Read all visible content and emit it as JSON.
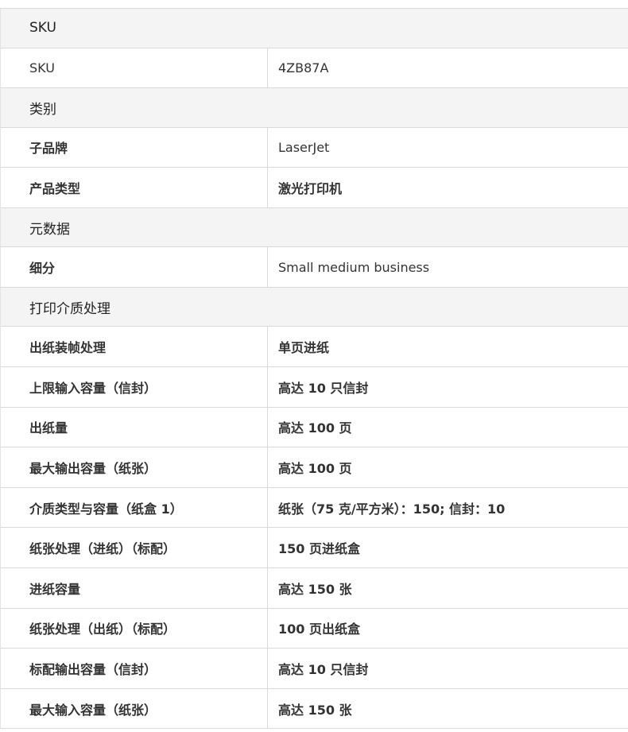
{
  "sections": [
    {
      "title": "SKU",
      "rows": [
        {
          "label": "SKU",
          "value": "4ZB87A"
        }
      ]
    },
    {
      "title": "类别",
      "rows": [
        {
          "label": "子品牌",
          "value": "LaserJet"
        },
        {
          "label": "产品类型",
          "value": "激光打印机"
        }
      ]
    },
    {
      "title": "元数据",
      "rows": [
        {
          "label": "细分",
          "value": "Small medium business"
        }
      ]
    },
    {
      "title": "打印介质处理",
      "rows": [
        {
          "label": "出纸装帧处理",
          "value": "单页进纸"
        },
        {
          "label": "上限输入容量（信封）",
          "value": "高达 10 只信封"
        },
        {
          "label": "出纸量",
          "value": "高达 100 页"
        },
        {
          "label": "最大输出容量（纸张）",
          "value": "高达 100 页"
        },
        {
          "label": "介质类型与容量（纸盒 1）",
          "value": "纸张（75 克/平方米）：150; 信封：10"
        },
        {
          "label": "纸张处理（进纸）（标配）",
          "value": "150 页进纸盒"
        },
        {
          "label": "进纸容量",
          "value": "高达 150 张"
        },
        {
          "label": "纸张处理（出纸）（标配）",
          "value": "100 页出纸盒"
        },
        {
          "label": "标配输出容量（信封）",
          "value": "高达 10 只信封"
        },
        {
          "label": "最大输入容量（纸张）",
          "value": "高达 150 张"
        }
      ]
    }
  ]
}
